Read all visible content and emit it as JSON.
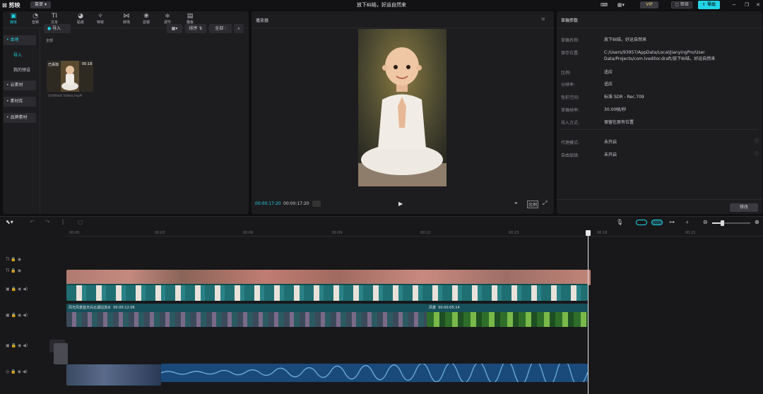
{
  "titlebar": {
    "logo": "剪映",
    "menu_label": "菜单",
    "project_title": "放下纠结，好运自然来",
    "vip_label": "VIP",
    "review_label": "审阅",
    "export_label": "导出"
  },
  "toolbar": {
    "tools": [
      {
        "label": "媒体",
        "icon": "media-icon",
        "glyph": "▣"
      },
      {
        "label": "音频",
        "icon": "audio-icon",
        "glyph": "◔"
      },
      {
        "label": "文本",
        "icon": "text-icon",
        "glyph": "TI"
      },
      {
        "label": "贴纸",
        "icon": "sticker-icon",
        "glyph": "◕"
      },
      {
        "label": "特效",
        "icon": "effect-icon",
        "glyph": "✧"
      },
      {
        "label": "转场",
        "icon": "transition-icon",
        "glyph": "⋈"
      },
      {
        "label": "滤镜",
        "icon": "filter-icon",
        "glyph": "❀"
      },
      {
        "label": "调节",
        "icon": "adjust-icon",
        "glyph": "≑"
      },
      {
        "label": "模板",
        "icon": "template-icon",
        "glyph": "▤"
      }
    ]
  },
  "sidebar": {
    "items": [
      {
        "label": "• 本地"
      },
      {
        "label": "导入"
      },
      {
        "label": "我的预设"
      },
      {
        "label": "• 云素材"
      },
      {
        "label": "• 素材库"
      },
      {
        "label": "• 品牌素材"
      }
    ]
  },
  "media": {
    "import_label": "导入",
    "sort_label": "排序",
    "all_filter_label": "全部",
    "all_label": "全部",
    "clip": {
      "added_label": "已添加",
      "duration": "00:18",
      "name": "Untitled Video.mp4"
    }
  },
  "player": {
    "title": "播放器",
    "current_time": "00:00:17:20",
    "total_time": "00:00:17:20"
  },
  "properties": {
    "title": "草稿参数",
    "rows": [
      {
        "label": "草稿名称:",
        "value": "放下纠结，好运自然来"
      },
      {
        "label": "保存位置:",
        "value": "C:/Users/93957/AppData/Local/JianyingPro/User Data/Projects/com.lveditor.draft/放下纠结，好运自然来"
      },
      {
        "label": "比例:",
        "value": "适应"
      },
      {
        "label": "分辨率:",
        "value": "适应"
      },
      {
        "label": "色彩空间:",
        "value": "标准 SDR - Rec.709"
      },
      {
        "label": "草稿帧率:",
        "value": "30.00帧/秒"
      },
      {
        "label": "导入方式:",
        "value": "保留在原有位置"
      },
      {
        "label": "代理模式:",
        "value": "未开启"
      },
      {
        "label": "自由层级:",
        "value": "未开启"
      }
    ],
    "modify_label": "修改"
  },
  "timeline": {
    "ruler": [
      "00:00",
      "00:03",
      "00:06",
      "00:09",
      "00:12",
      "00:15",
      "00:18",
      "00:21"
    ],
    "clips": {
      "video_main_label": "风光风景蓝天白云湖泊流水",
      "video_main_duration": "00:00:12:06",
      "video_second_label": "风景",
      "video_second_duration": "00:00:05:14",
      "cover_label": "封面"
    }
  }
}
